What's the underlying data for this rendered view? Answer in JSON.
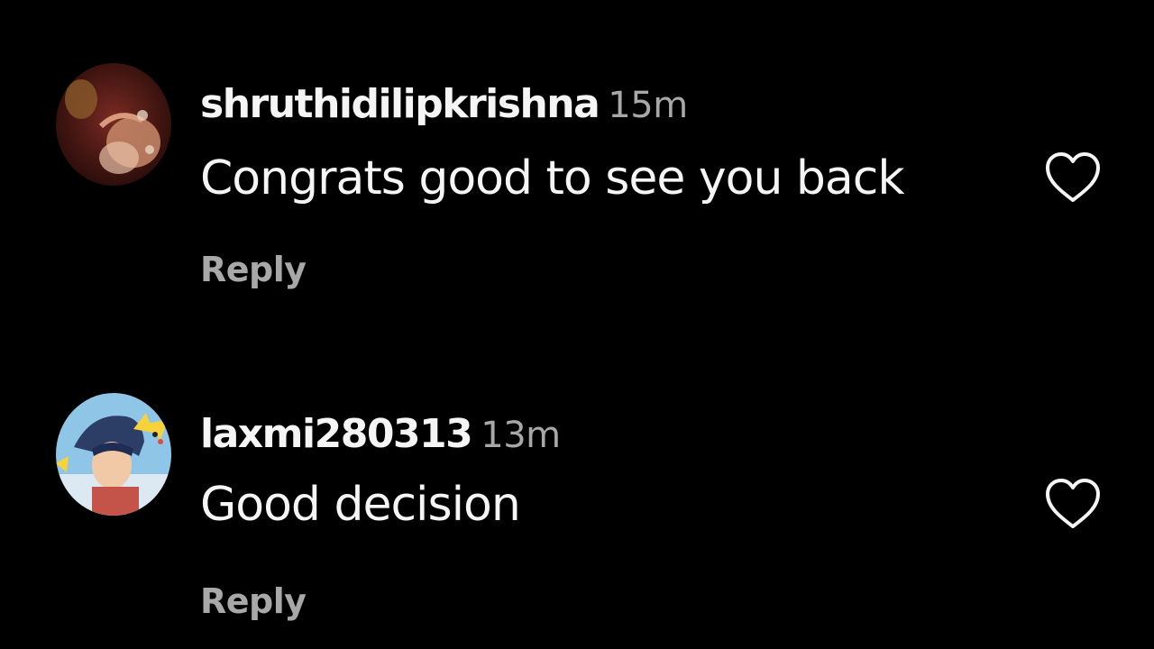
{
  "colors": {
    "background": "#000000",
    "text": "#f5f5f5",
    "secondary": "#a8a8a8"
  },
  "comments": [
    {
      "username": "shruthidilipkrishna",
      "time": "15m",
      "text": "Congrats good to see you back",
      "reply_label": "Reply",
      "avatar": "profile-photo",
      "like_icon": "heart-outline-icon"
    },
    {
      "username": "laxmi280313",
      "time": "13m",
      "text": "Good decision",
      "reply_label": "Reply",
      "avatar": "cartoon-profile-photo",
      "like_icon": "heart-outline-icon"
    }
  ]
}
